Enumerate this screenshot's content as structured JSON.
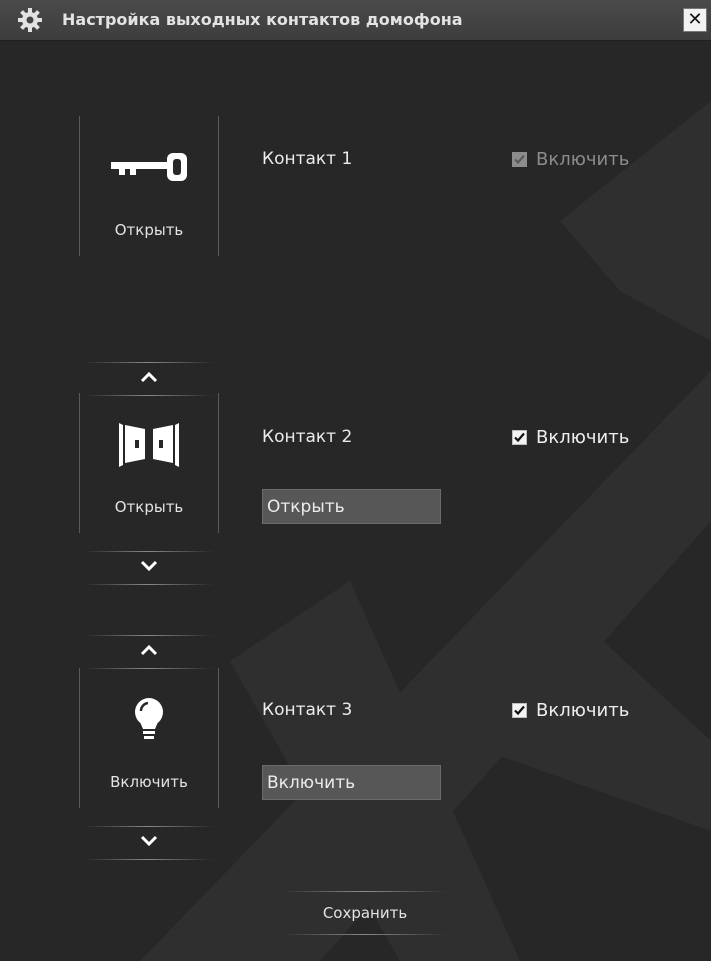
{
  "window": {
    "title": "Настройка выходных контактов домофона",
    "title_icon": "gear-icon",
    "close_label": "✕"
  },
  "contacts": [
    {
      "title": "Контакт 1",
      "icon": "key-icon",
      "action_label": "Открыть",
      "enable_label": "Включить",
      "enabled": true,
      "enable_disabled": true
    },
    {
      "title": "Контакт 2",
      "icon": "door-icon",
      "action_label": "Открыть",
      "enable_label": "Включить",
      "enabled": true,
      "name_value": "Открыть"
    },
    {
      "title": "Контакт 3",
      "icon": "lightbulb-icon",
      "action_label": "Включить",
      "enable_label": "Включить",
      "enabled": true,
      "name_value": "Включить"
    }
  ],
  "save_label": "Сохранить",
  "colors": {
    "background": "#272727",
    "titlebar": "#444444",
    "text": "#ececec",
    "input": "#575757"
  }
}
